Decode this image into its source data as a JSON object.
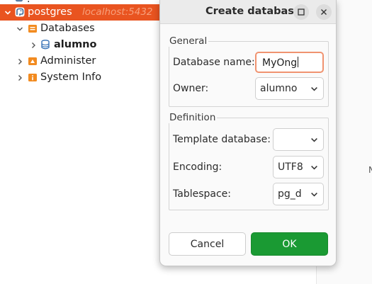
{
  "tree": {
    "server": {
      "label": "postgres",
      "host": "localhost:5432"
    },
    "databases": {
      "label": "Databases"
    },
    "database_item": {
      "label": "alumno"
    },
    "administer": {
      "label": "Administer"
    },
    "system_info": {
      "label": "System Info"
    }
  },
  "dialog": {
    "title": "Create database",
    "general": {
      "title": "General",
      "database_name_label": "Database name:",
      "database_name_value": "MyOng",
      "owner_label": "Owner:",
      "owner_value": "alumno"
    },
    "definition": {
      "title": "Definition",
      "template_label": "Template database:",
      "template_value": "",
      "encoding_label": "Encoding:",
      "encoding_value": "UTF8",
      "tablespace_label": "Tablespace:",
      "tablespace_value": "pg_d"
    },
    "cancel_label": "Cancel",
    "ok_label": "OK"
  },
  "background": {
    "mark": "N"
  },
  "colors": {
    "selection": "#e95420",
    "ok_button": "#1a9a33",
    "focus_border": "#f09370",
    "folder": "#f28b20"
  }
}
